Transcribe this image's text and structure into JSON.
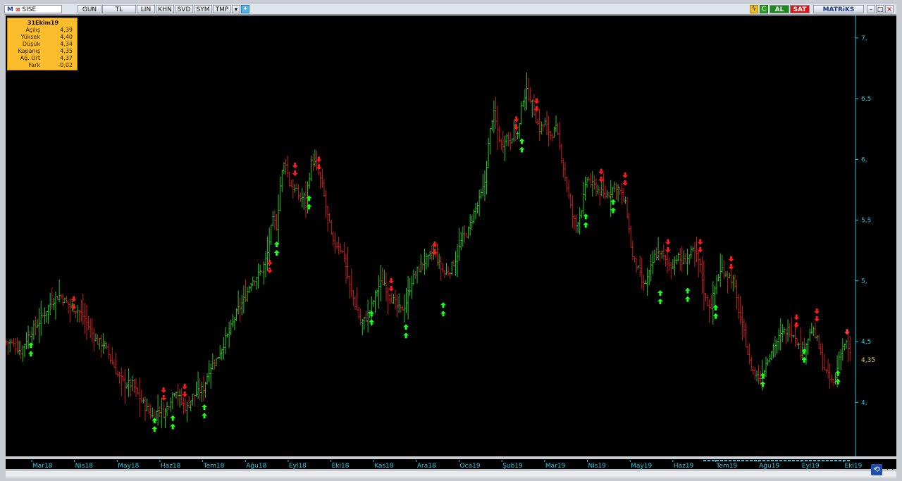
{
  "app": {
    "symbol": "SISE",
    "symbol_prefix": "M",
    "toolbar_buttons": [
      "GUN",
      "TL",
      "LIN",
      "KHN",
      "SVD",
      "SYM",
      "TMP"
    ],
    "right_buttons": {
      "buy": "AL",
      "sell": "SAT",
      "brand": "MATRiKS"
    },
    "colors": {
      "bg": "#000000",
      "up": "#1ec91e",
      "down": "#c81e1e",
      "axis": "#20c8e0",
      "last": "#e8d040",
      "info_bg": "#fbbd2b"
    }
  },
  "info": {
    "date": "31Ekim19",
    "rows": [
      {
        "label": "Açılış",
        "value": "4,39"
      },
      {
        "label": "Yüksek",
        "value": "4,40"
      },
      {
        "label": "Düşük",
        "value": "4,34"
      },
      {
        "label": "Kapanış",
        "value": "4,35"
      },
      {
        "label": "Ağ. Ort",
        "value": "4,37"
      },
      {
        "label": "Fark",
        "value": "-0,02"
      }
    ]
  },
  "chart_data": {
    "type": "bar",
    "subtype": "ohlc",
    "x_axis_labels": [
      "Mar18",
      "Nis18",
      "May18",
      "Haz18",
      "Tem18",
      "Ağu18",
      "Eyl18",
      "Eki18",
      "Kas18",
      "Ara18",
      "Oca19",
      "Şub19",
      "Mar19",
      "Nis19",
      "May19",
      "Haz19",
      "Tem19",
      "Ağu19",
      "Eyl19",
      "Eki19"
    ],
    "y_ticks": [
      "4,",
      "4,5",
      "5,",
      "5,5",
      "6,",
      "6,5",
      "7,"
    ],
    "y_tick_values": [
      4.0,
      4.5,
      5.0,
      5.5,
      6.0,
      6.5,
      7.0
    ],
    "ylim": [
      3.7,
      7.15
    ],
    "last_price_label": "4,35",
    "last_price": 4.35,
    "series": [
      {
        "type": "close_path",
        "points": [
          [
            0,
            4.5
          ],
          [
            10,
            4.48
          ],
          [
            22,
            4.42
          ],
          [
            32,
            4.55
          ],
          [
            42,
            4.62
          ],
          [
            52,
            4.7
          ],
          [
            62,
            4.8
          ],
          [
            70,
            4.86
          ],
          [
            78,
            4.88
          ],
          [
            86,
            4.82
          ],
          [
            96,
            4.78
          ],
          [
            104,
            4.75
          ],
          [
            112,
            4.7
          ],
          [
            120,
            4.6
          ],
          [
            130,
            4.5
          ],
          [
            140,
            4.48
          ],
          [
            150,
            4.35
          ],
          [
            160,
            4.22
          ],
          [
            170,
            4.15
          ],
          [
            180,
            4.15
          ],
          [
            190,
            4.05
          ],
          [
            200,
            3.95
          ],
          [
            210,
            3.88
          ],
          [
            218,
            3.95
          ],
          [
            226,
            3.9
          ],
          [
            234,
            4.02
          ],
          [
            242,
            4.12
          ],
          [
            250,
            4.0
          ],
          [
            258,
            3.95
          ],
          [
            266,
            4.05
          ],
          [
            274,
            4.08
          ],
          [
            282,
            4.12
          ],
          [
            290,
            4.28
          ],
          [
            300,
            4.35
          ],
          [
            310,
            4.48
          ],
          [
            320,
            4.6
          ],
          [
            330,
            4.75
          ],
          [
            340,
            4.85
          ],
          [
            350,
            5.0
          ],
          [
            360,
            5.05
          ],
          [
            366,
            5.1
          ],
          [
            372,
            5.2
          ],
          [
            380,
            5.5
          ],
          [
            386,
            5.45
          ],
          [
            392,
            5.85
          ],
          [
            398,
            6.0
          ],
          [
            404,
            5.8
          ],
          [
            412,
            5.75
          ],
          [
            420,
            5.68
          ],
          [
            428,
            5.7
          ],
          [
            436,
            6.0
          ],
          [
            442,
            5.95
          ],
          [
            450,
            5.8
          ],
          [
            458,
            5.55
          ],
          [
            466,
            5.3
          ],
          [
            474,
            5.3
          ],
          [
            482,
            5.2
          ],
          [
            490,
            4.95
          ],
          [
            498,
            4.8
          ],
          [
            506,
            4.65
          ],
          [
            514,
            4.7
          ],
          [
            522,
            4.8
          ],
          [
            530,
            4.95
          ],
          [
            538,
            5.0
          ],
          [
            546,
            4.88
          ],
          [
            554,
            4.82
          ],
          [
            562,
            4.75
          ],
          [
            570,
            4.82
          ],
          [
            578,
            5.0
          ],
          [
            586,
            5.08
          ],
          [
            594,
            5.15
          ],
          [
            602,
            5.18
          ],
          [
            610,
            5.25
          ],
          [
            618,
            5.12
          ],
          [
            626,
            5.05
          ],
          [
            634,
            5.1
          ],
          [
            642,
            5.2
          ],
          [
            650,
            5.35
          ],
          [
            658,
            5.4
          ],
          [
            666,
            5.55
          ],
          [
            674,
            5.65
          ],
          [
            682,
            5.8
          ],
          [
            688,
            6.15
          ],
          [
            694,
            6.4
          ],
          [
            700,
            6.25
          ],
          [
            706,
            6.1
          ],
          [
            712,
            6.2
          ],
          [
            718,
            6.15
          ],
          [
            724,
            6.25
          ],
          [
            730,
            6.2
          ],
          [
            736,
            6.5
          ],
          [
            742,
            6.55
          ],
          [
            748,
            6.5
          ],
          [
            754,
            6.35
          ],
          [
            760,
            6.25
          ],
          [
            768,
            6.3
          ],
          [
            776,
            6.2
          ],
          [
            784,
            6.25
          ],
          [
            792,
            6.0
          ],
          [
            800,
            5.75
          ],
          [
            806,
            5.55
          ],
          [
            812,
            5.45
          ],
          [
            820,
            5.6
          ],
          [
            828,
            5.85
          ],
          [
            836,
            5.78
          ],
          [
            844,
            5.75
          ],
          [
            852,
            5.7
          ],
          [
            860,
            5.72
          ],
          [
            868,
            5.8
          ],
          [
            876,
            5.72
          ],
          [
            884,
            5.6
          ],
          [
            892,
            5.2
          ],
          [
            900,
            5.1
          ],
          [
            908,
            4.95
          ],
          [
            916,
            5.05
          ],
          [
            924,
            5.2
          ],
          [
            932,
            5.25
          ],
          [
            940,
            5.15
          ],
          [
            948,
            5.12
          ],
          [
            956,
            5.2
          ],
          [
            964,
            5.15
          ],
          [
            972,
            5.2
          ],
          [
            980,
            5.25
          ],
          [
            988,
            5.15
          ],
          [
            996,
            4.85
          ],
          [
            1004,
            4.78
          ],
          [
            1012,
            5.0
          ],
          [
            1020,
            5.1
          ],
          [
            1028,
            5.05
          ],
          [
            1036,
            5.0
          ],
          [
            1044,
            4.75
          ],
          [
            1052,
            4.55
          ],
          [
            1060,
            4.3
          ],
          [
            1068,
            4.22
          ],
          [
            1076,
            4.2
          ],
          [
            1084,
            4.35
          ],
          [
            1092,
            4.45
          ],
          [
            1100,
            4.52
          ],
          [
            1108,
            4.58
          ],
          [
            1116,
            4.6
          ],
          [
            1124,
            4.55
          ],
          [
            1132,
            4.42
          ],
          [
            1140,
            4.5
          ],
          [
            1148,
            4.6
          ],
          [
            1156,
            4.5
          ],
          [
            1164,
            4.3
          ],
          [
            1172,
            4.2
          ],
          [
            1180,
            4.15
          ],
          [
            1188,
            4.42
          ],
          [
            1196,
            4.5
          ],
          [
            1204,
            4.35
          ]
        ]
      }
    ],
    "signals": {
      "buy": [
        [
          36,
          4.47
        ],
        [
          212,
          3.85
        ],
        [
          238,
          3.87
        ],
        [
          283,
          3.96
        ],
        [
          386,
          5.3
        ],
        [
          432,
          5.68
        ],
        [
          521,
          4.73
        ],
        [
          570,
          4.62
        ],
        [
          623,
          4.8
        ],
        [
          735,
          6.15
        ],
        [
          826,
          5.53
        ],
        [
          865,
          5.65
        ],
        [
          932,
          4.9
        ],
        [
          971,
          4.92
        ],
        [
          1011,
          4.78
        ],
        [
          1078,
          4.22
        ],
        [
          1137,
          4.42
        ],
        [
          1185,
          4.24
        ]
      ],
      "sell": [
        [
          97,
          4.85
        ],
        [
          225,
          4.1
        ],
        [
          255,
          4.13
        ],
        [
          376,
          5.15
        ],
        [
          412,
          5.95
        ],
        [
          446,
          6.0
        ],
        [
          549,
          5.0
        ],
        [
          611,
          5.3
        ],
        [
          727,
          6.33
        ],
        [
          756,
          6.48
        ],
        [
          848,
          5.9
        ],
        [
          882,
          5.87
        ],
        [
          943,
          5.32
        ],
        [
          989,
          5.32
        ],
        [
          1033,
          5.18
        ],
        [
          1126,
          4.7
        ],
        [
          1155,
          4.75
        ]
      ]
    }
  }
}
